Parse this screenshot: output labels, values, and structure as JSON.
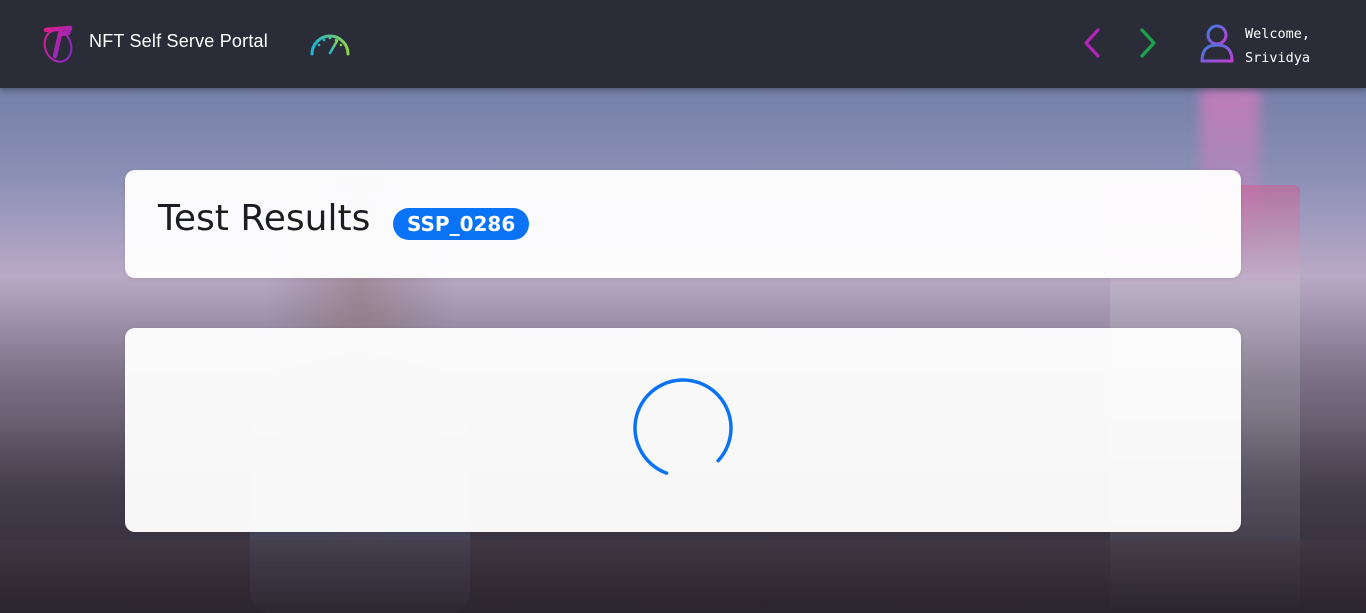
{
  "header": {
    "app_title": "NFT Self Serve Portal",
    "welcome_line1": "Welcome,",
    "welcome_line2": "Srividya",
    "icons": {
      "logo": "telstra-logo-icon",
      "dashboard": "speedometer-icon",
      "back": "chevron-left-icon",
      "forward": "chevron-right-icon",
      "user": "user-icon"
    }
  },
  "results": {
    "title": "Test Results",
    "test_id": "SSP_0286",
    "status": "loading"
  },
  "colors": {
    "header_bg": "#2a2d38",
    "badge": "#0a72f5",
    "spinner": "#0a72f5",
    "back_arrow": "#b224b8",
    "forward_arrow": "#1aa34a"
  }
}
